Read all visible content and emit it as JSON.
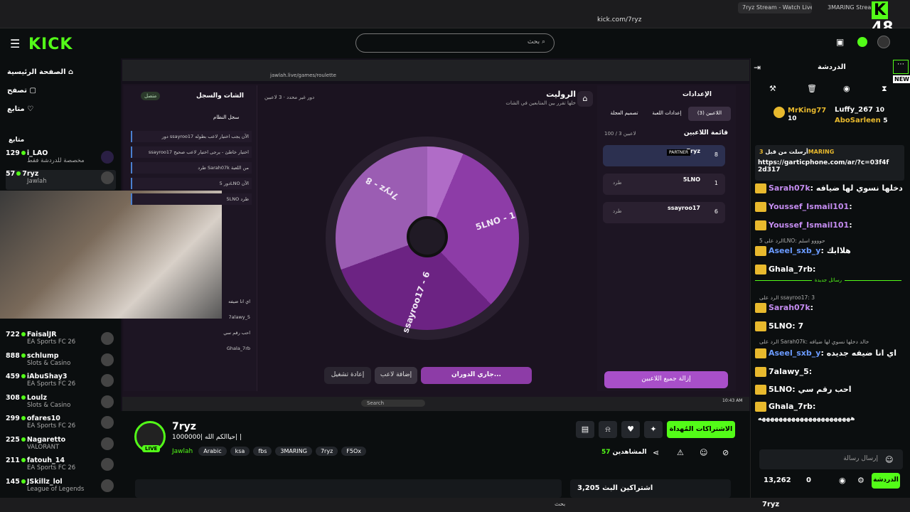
{
  "browser": {
    "tabs": [
      "7ryz Stream - Watch Live on Kick",
      "3MARING Stream - Watc"
    ],
    "url": "kick.com/7ryz",
    "counter": "48"
  },
  "header": {
    "logo": "KICK",
    "search_placeholder": "بحث"
  },
  "sidebar": {
    "nav": [
      "الصفحة الرئيسية",
      "تصفح",
      "متابع"
    ],
    "section": "متابع",
    "followed": [
      {
        "count": "129",
        "name": "i_LAO",
        "sub": "مخصصة للدردشة فقط"
      },
      {
        "count": "57",
        "name": "7ryz",
        "sub": "Jawlah"
      }
    ],
    "channels": [
      {
        "count": "722",
        "name": "FaisalJR",
        "sub": "EA Sports FC 26"
      },
      {
        "count": "888",
        "name": "schlump",
        "sub": "Slots & Casino"
      },
      {
        "count": "459",
        "name": "iAbuShay3",
        "sub": "EA Sports FC 26"
      },
      {
        "count": "308",
        "name": "Loulz",
        "sub": "Slots & Casino"
      },
      {
        "count": "299",
        "name": "ofares10",
        "sub": "EA Sports FC 26"
      },
      {
        "count": "225",
        "name": "Nagaretto",
        "sub": "VALORANT"
      },
      {
        "count": "211",
        "name": "fatouh_14",
        "sub": "EA Sports FC 26"
      },
      {
        "count": "145",
        "name": "JSkillz_lol",
        "sub": "League of Legends"
      }
    ]
  },
  "game": {
    "url": "jawlah.live/games/roulette",
    "title": "الروليت",
    "subtitle": "خلها تقرر بين المتابعين في الشات",
    "players_info": "3 لاعبين",
    "round": "دور غير محدد",
    "left_title": "الشات والسجل",
    "left_status": "متصل",
    "log_title": "سجل النظام",
    "log": [
      "دور ssayroo17 الآن يجب اختيار لاعب بطوله",
      "ssayroo17 اختيار خاطئ - يرجى اختيار لاعب صحيح",
      "طرد Sarah07k من اللعبة",
      "دور 5LNO الآن",
      "5LNO طرد"
    ],
    "chat_small": [
      "اي انا ضيفه",
      "7alawy_5",
      "احب رقم سي",
      "Ghala_7rb"
    ],
    "settings_title": "الإعدادات",
    "tabs": [
      "اللاعبين (3)",
      "إعدادات اللعبة",
      "تصميم العجلة"
    ],
    "list_title": "قائمة اللاعبين",
    "list_count": "100 / 3 لاعبين",
    "players": [
      {
        "name": "7ryz",
        "num": "8",
        "badge": "PARTNER"
      },
      {
        "name": "5LNO",
        "num": "1",
        "badge": ""
      },
      {
        "name": "ssayroo17",
        "num": "6",
        "badge": ""
      }
    ],
    "kick_label": "طرد",
    "remove_all": "إزالة جميع اللاعبين",
    "wheel": [
      "5LNO - 1",
      "ssayroo17 - 6",
      "7ryz - 8"
    ],
    "buttons": {
      "spin": "جاري الدوران...",
      "add": "إضافة لاعب",
      "restart": "إعادة تشغيل"
    },
    "taskbar_search": "Search",
    "clock": "10:43 AM"
  },
  "channel": {
    "name": "7ryz",
    "live": "LIVE",
    "title": "حياالكم الله |1000000| |",
    "category": "Jawlah",
    "tags": [
      "Arabic",
      "ksa",
      "fbs",
      "3MARING",
      "7ryz",
      "F5Ox"
    ],
    "follow": "الاشتراكات المُهداة",
    "viewers": "57",
    "viewers_label": "المشاهدين",
    "since": "اشتراكين البث 3,205"
  },
  "chat": {
    "title": "الدردشة",
    "new_label": "NEW",
    "top": [
      {
        "name": "MrKing77",
        "num": "10"
      },
      {
        "name": "Luffy_267",
        "num": "10"
      },
      {
        "name": "AboSarleen",
        "num": "5"
      }
    ],
    "pinned_by": "3MARING",
    "pinned_label": "أرسلت من قبل",
    "pinned_link": "https://garticphone.com/ar/?c=03f4f2d317",
    "messages": [
      {
        "user": "Sarah07k",
        "text": "خالد دخلها نسوي لها ضيافه",
        "color": "#c48cf0"
      },
      {
        "user": "Youssef_Ismail101",
        "text": "",
        "color": "#c48cf0"
      },
      {
        "user": "Youssef_Ismail101",
        "text": "",
        "color": "#c48cf0"
      },
      {
        "user": "Aseel_sxb_y",
        "text": "هلاابك",
        "color": "#6b9bff"
      },
      {
        "user": "Ghala_7rb",
        "text": "",
        "color": "#fff"
      },
      {
        "user": "Sarah07k",
        "text": "",
        "color": "#c48cf0"
      },
      {
        "user": "5LNO",
        "text": "7",
        "color": "#fff"
      },
      {
        "user": "Aseel_sxb_y",
        "text": "اي انا ضيفه جديده",
        "color": "#6b9bff"
      },
      {
        "user": "7alawy_5",
        "text": "",
        "color": "#fff"
      },
      {
        "user": "5LNO",
        "text": "احب رقم سي",
        "color": "#fff"
      },
      {
        "user": "Ghala_7rb",
        "text": "",
        "color": "#fff"
      }
    ],
    "replies": [
      "الرد على 5LNO: حوووو اسلم",
      "الرد على ssayroo17: 3",
      "الرد على Sarah07k: خالد دخلها نسوي لها ضيافه"
    ],
    "new_msgs": "رسائل جديدة",
    "long_line": "ههههههههههههههههههههههه",
    "input_placeholder": "إرسال رسالة",
    "points": "13,262",
    "zero": "0",
    "send": "الدردشة"
  },
  "wintask": {
    "search": "بحث",
    "user": "7ryz"
  }
}
